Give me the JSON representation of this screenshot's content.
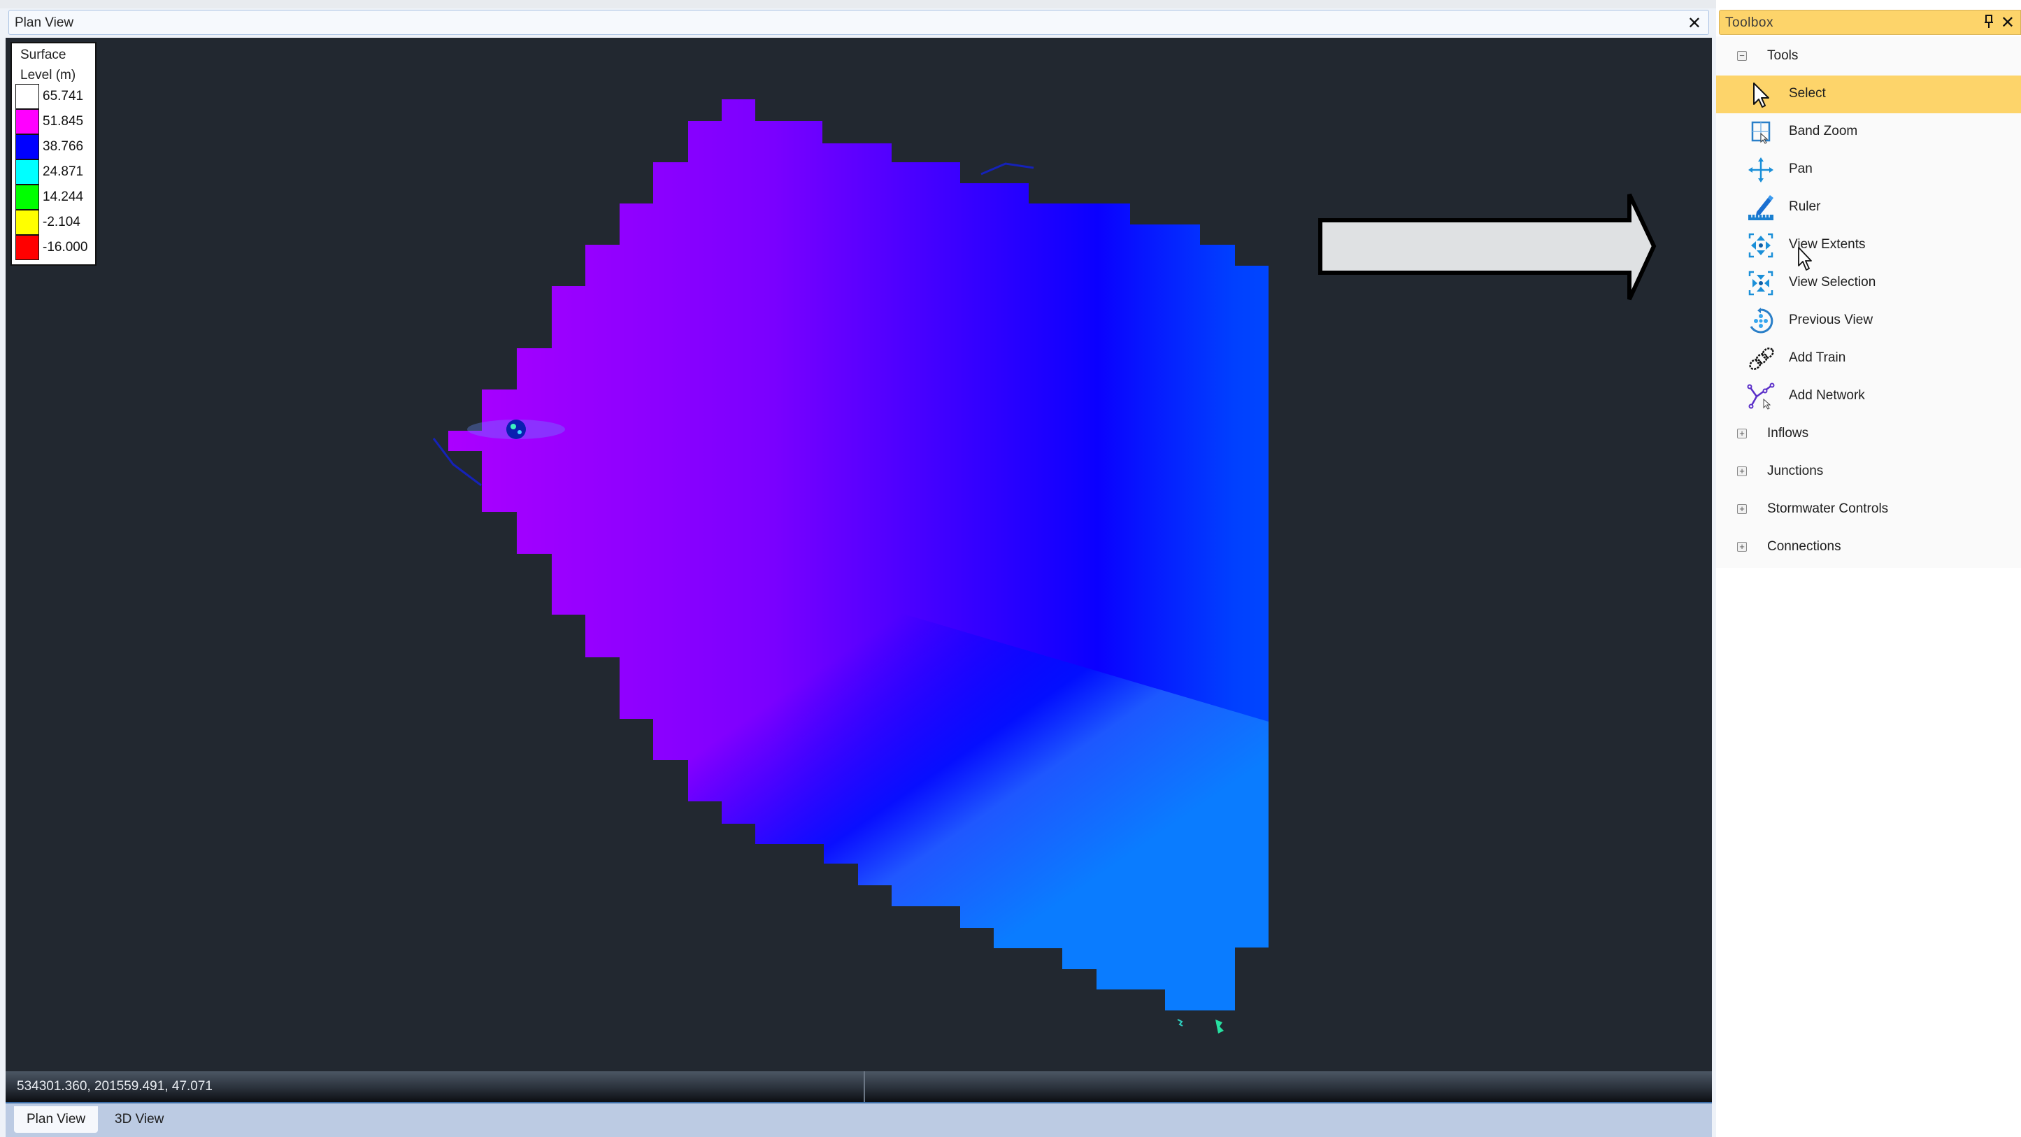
{
  "plan_view": {
    "title": "Plan View",
    "close_label": "✕",
    "legend": {
      "title_line1": "Surface",
      "title_line2": "Level (m)",
      "entries": [
        {
          "value": "65.741",
          "color": "#ffffff"
        },
        {
          "value": "51.845",
          "color": "#ff00ff"
        },
        {
          "value": "38.766",
          "color": "#0000ff"
        },
        {
          "value": "24.871",
          "color": "#00ffff"
        },
        {
          "value": "14.244",
          "color": "#00ff00"
        },
        {
          "value": "-2.104",
          "color": "#ffff00"
        },
        {
          "value": "-16.000",
          "color": "#ff0000"
        }
      ]
    },
    "status_coords": "534301.360, 201559.491, 47.071"
  },
  "bottom_tabs": [
    {
      "label": "Plan View",
      "active": true
    },
    {
      "label": "3D View",
      "active": false
    }
  ],
  "toolbox": {
    "title": "Toolbox",
    "pin_label": "📌",
    "close_label": "✕",
    "groups": [
      {
        "label": "Tools",
        "expanded": true,
        "expander": "−",
        "items": [
          {
            "label": "Select",
            "icon": "pointer-arrow-icon",
            "selected": true
          },
          {
            "label": "Band Zoom",
            "icon": "band-zoom-icon",
            "selected": false
          },
          {
            "label": "Pan",
            "icon": "pan-icon",
            "selected": false
          },
          {
            "label": "Ruler",
            "icon": "ruler-icon",
            "selected": false
          },
          {
            "label": "View Extents",
            "icon": "view-extents-icon",
            "selected": false
          },
          {
            "label": "View Selection",
            "icon": "view-selection-icon",
            "selected": false
          },
          {
            "label": "Previous View",
            "icon": "previous-view-icon",
            "selected": false
          },
          {
            "label": "Add Train",
            "icon": "add-train-icon",
            "selected": false
          },
          {
            "label": "Add Network",
            "icon": "add-network-icon",
            "selected": false
          }
        ]
      },
      {
        "label": "Inflows",
        "expanded": false,
        "expander": "+"
      },
      {
        "label": "Junctions",
        "expanded": false,
        "expander": "+"
      },
      {
        "label": "Stormwater Controls",
        "expanded": false,
        "expander": "+"
      },
      {
        "label": "Connections",
        "expanded": false,
        "expander": "+"
      }
    ]
  },
  "colors": {
    "selection_highlight": "#fdd46a",
    "canvas_background": "#222830",
    "icon_blue": "#1a8fd8"
  }
}
